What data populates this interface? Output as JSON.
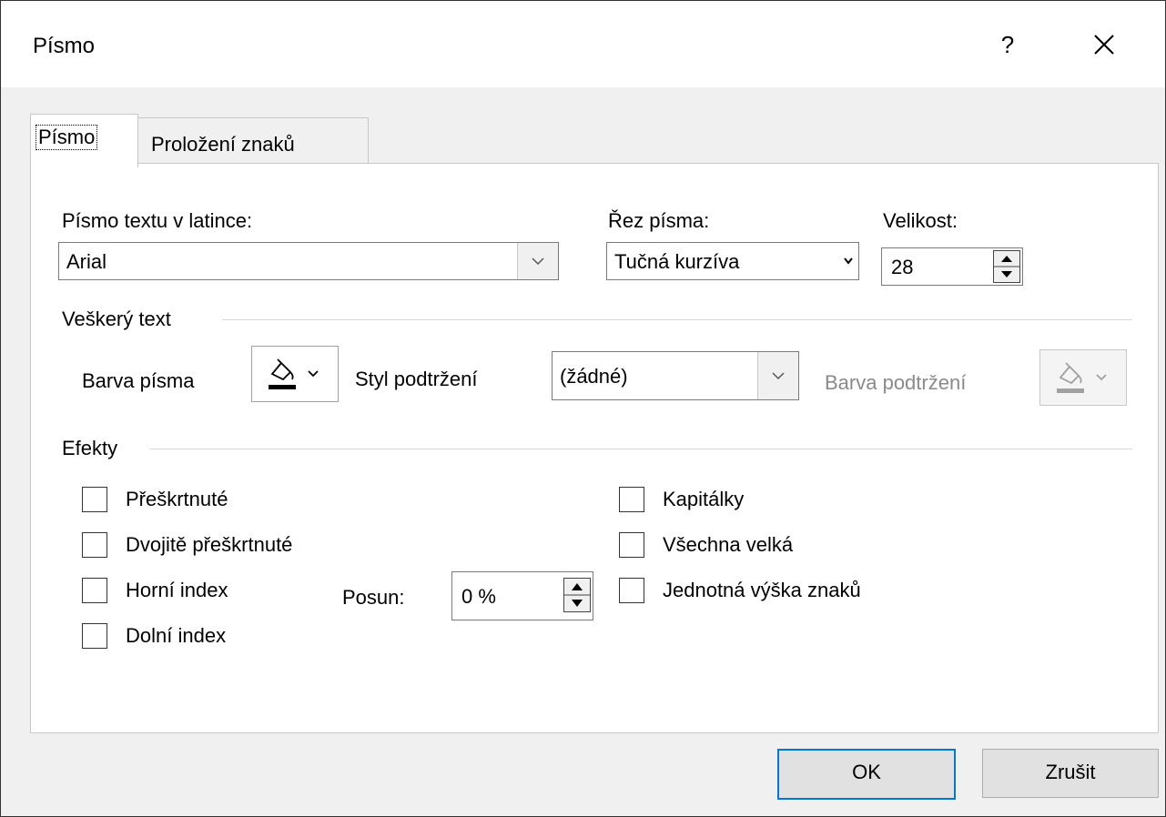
{
  "dialog": {
    "title": "Písmo",
    "help_label": "?"
  },
  "tabs": [
    {
      "label": "Písmo"
    },
    {
      "label": "Proložení znaků"
    }
  ],
  "font": {
    "latin_label": "Písmo textu v latince:",
    "latin_value": "Arial",
    "style_label": "Řez písma:",
    "style_value": "Tučná kurzíva",
    "size_label": "Velikost:",
    "size_value": "28"
  },
  "all_text": {
    "group_label": "Veškerý text",
    "font_color_label": "Barva písma",
    "font_color": "#000000",
    "underline_style_label": "Styl podtržení",
    "underline_style_value": "(žádné)",
    "underline_color_label": "Barva podtržení",
    "underline_color": "#a0a0a0"
  },
  "effects": {
    "group_label": "Efekty",
    "left": [
      {
        "label": "Přeškrtnuté",
        "checked": false
      },
      {
        "label": "Dvojitě přeškrtnuté",
        "checked": false
      },
      {
        "label": "Horní index",
        "checked": false
      },
      {
        "label": "Dolní index",
        "checked": false
      }
    ],
    "right": [
      {
        "label": "Kapitálky",
        "checked": false
      },
      {
        "label": "Všechna velká",
        "checked": false
      },
      {
        "label": "Jednotná výška znaků",
        "checked": false
      }
    ],
    "offset_label": "Posun:",
    "offset_value": "0 %"
  },
  "buttons": {
    "ok": "OK",
    "cancel": "Zrušit"
  },
  "colors": {
    "accent": "#0078d7",
    "dialog_bg": "#f0f0f0"
  }
}
